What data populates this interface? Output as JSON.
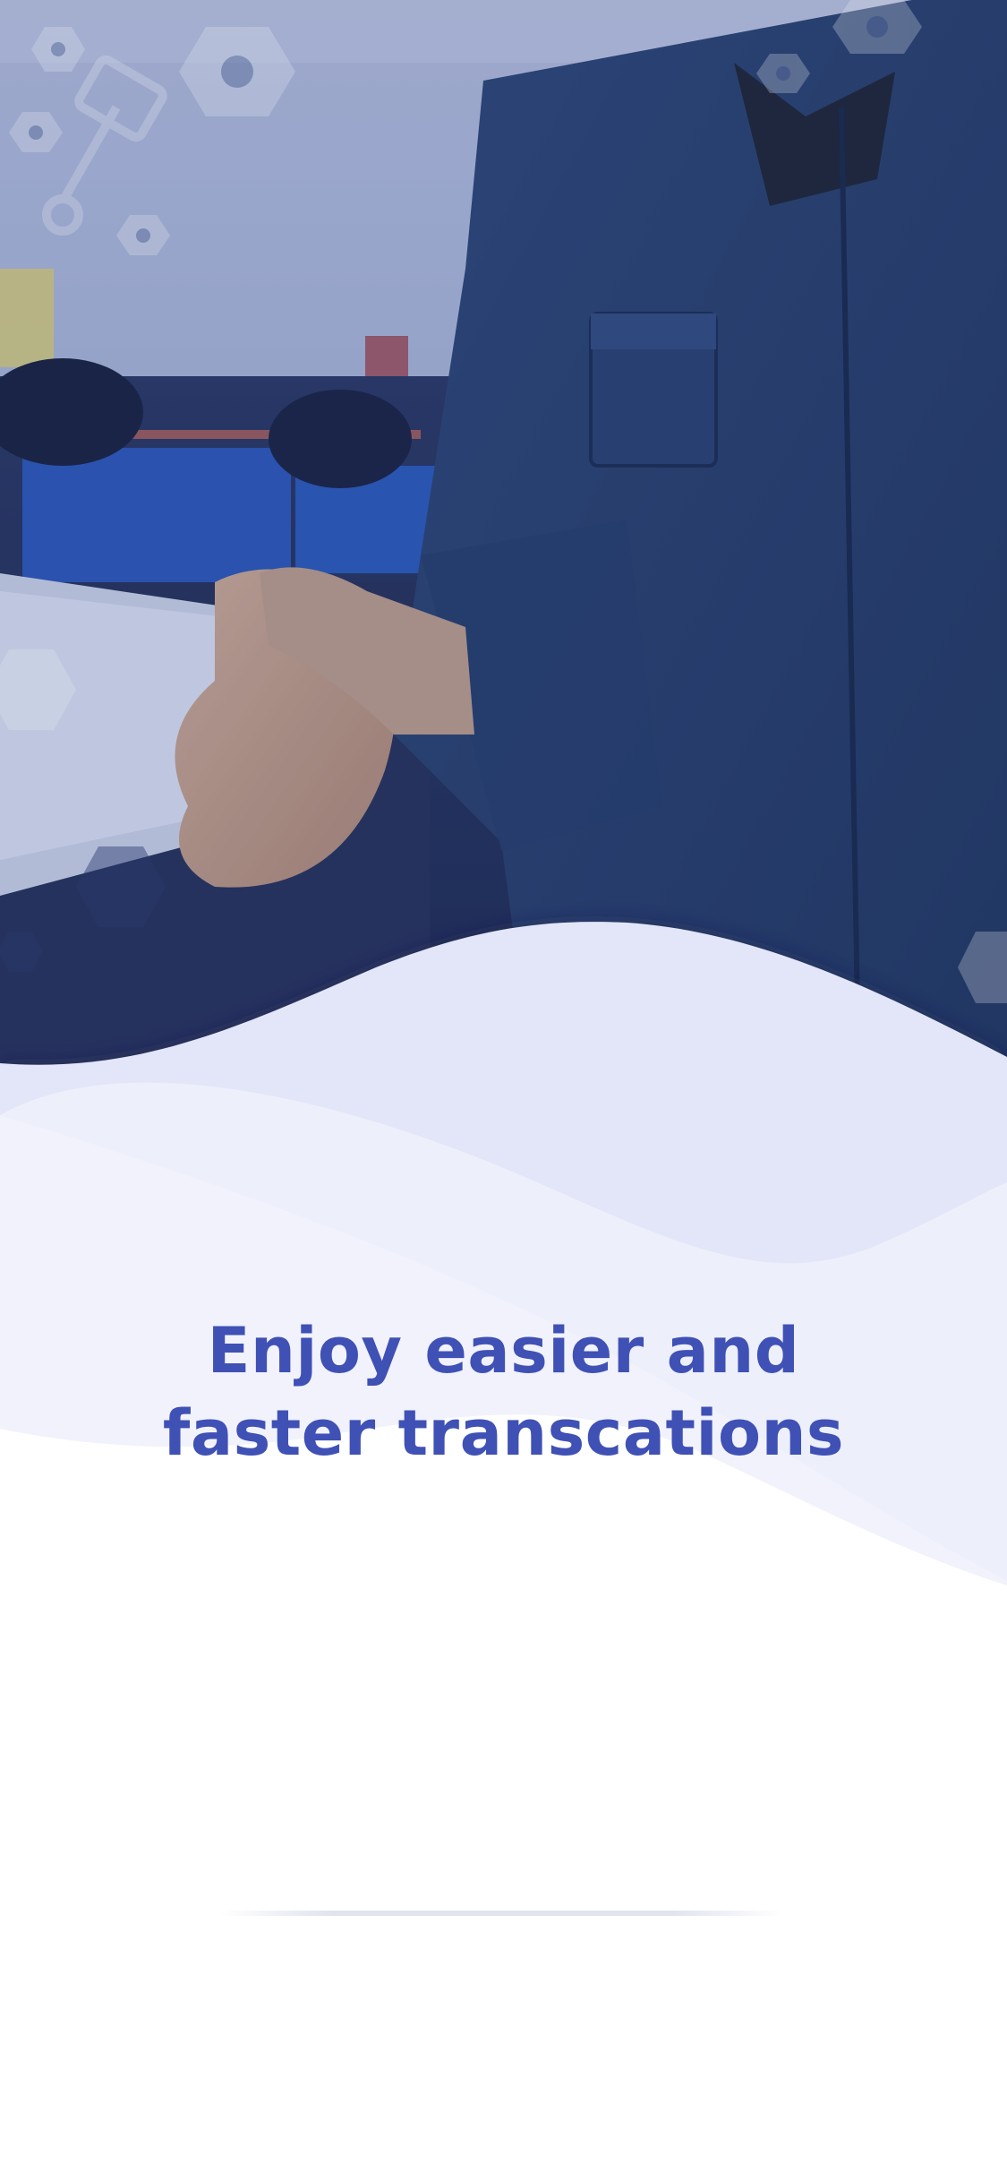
{
  "onboarding": {
    "headline_line1": "Enjoy easier and",
    "headline_line2": "faster transcations",
    "hero_image": "handshake-in-auto-workshop-photo",
    "accent_color": "#3f51b5",
    "overlay_color": "#1f3a78"
  }
}
